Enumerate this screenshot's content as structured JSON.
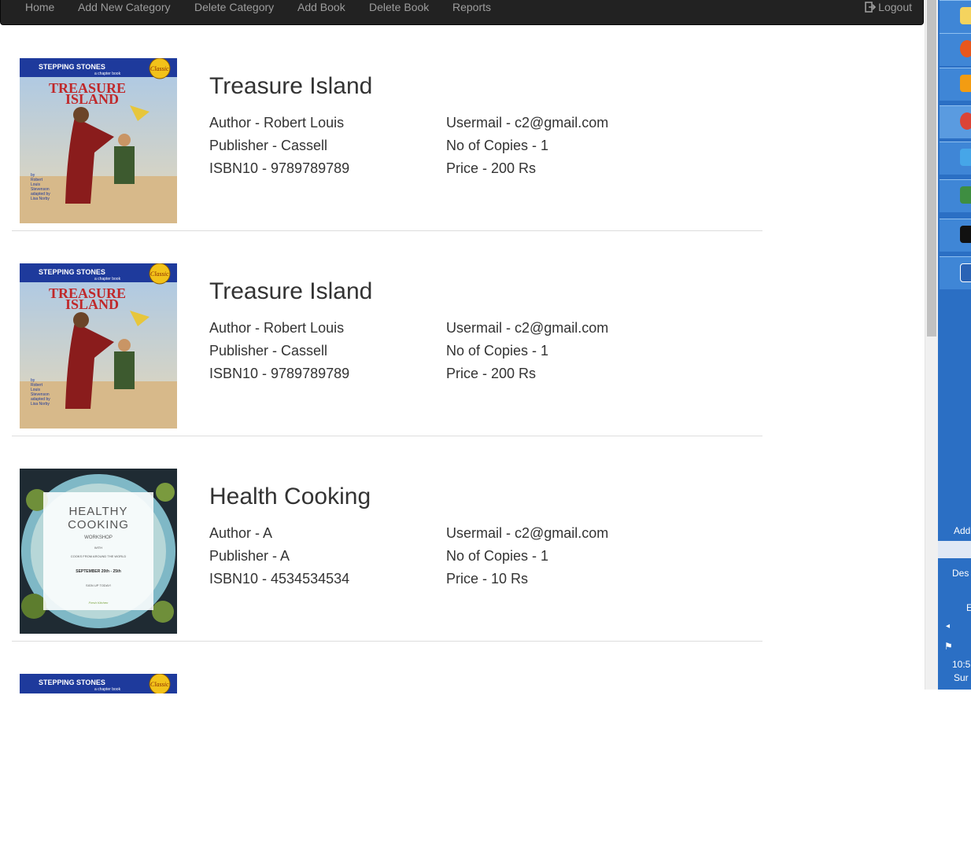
{
  "nav": {
    "items": [
      "Home",
      "Add New Category",
      "Delete Category",
      "Add Book",
      "Delete Book",
      "Reports"
    ],
    "logout": "Logout"
  },
  "books": [
    {
      "title": "Treasure Island",
      "author": "Author - Robert Louis",
      "publisher": "Publisher - Cassell",
      "isbn": "ISBN10 - 9789789789",
      "usermail": "Usermail - c2@gmail.com",
      "copies": "No of Copies - 1",
      "price": "Price - 200 Rs",
      "cover": {
        "series": "STEPPING STONES",
        "tagline": "a chapter book",
        "badge": "Classic",
        "title1": "TREASURE",
        "title2": "ISLAND",
        "credits": [
          "by",
          "Robert",
          "Louis",
          "Stevenson",
          "adapted by",
          "Lisa Norby"
        ]
      }
    },
    {
      "title": "Treasure Island",
      "author": "Author - Robert Louis",
      "publisher": "Publisher - Cassell",
      "isbn": "ISBN10 - 9789789789",
      "usermail": "Usermail - c2@gmail.com",
      "copies": "No of Copies - 1",
      "price": "Price - 200 Rs",
      "cover": {
        "series": "STEPPING STONES",
        "tagline": "a chapter book",
        "badge": "Classic",
        "title1": "TREASURE",
        "title2": "ISLAND",
        "credits": [
          "by",
          "Robert",
          "Louis",
          "Stevenson",
          "adapted by",
          "Lisa Norby"
        ]
      }
    },
    {
      "title": "Health Cooking",
      "author": "Author - A",
      "publisher": "Publisher - A",
      "isbn": "ISBN10 - 4534534534",
      "usermail": "Usermail - c2@gmail.com",
      "copies": "No of Copies - 1",
      "price": "Price - 10 Rs",
      "cover": {
        "title1": "HEALTHY",
        "title2": "COOKING",
        "subtitle": "WORKSHOP",
        "with": "WITH",
        "line1": "COOKS FROM AROUND THE WORLD",
        "dates": "SEPTEMBER 20th - 25th",
        "signup": "SIGN UP TODAY!",
        "sign": "Fresh Kitchen"
      }
    },
    {
      "cover": {
        "series": "STEPPING STONES",
        "tagline": "a chapter book",
        "badge": "Classic"
      }
    }
  ],
  "taskbar": {
    "labels": [
      "Add",
      "Des",
      "E",
      "10:5",
      "Sur"
    ]
  },
  "colors": {
    "navbar_bg": "#222222",
    "nav_text": "#9d9d9d",
    "taskbar_blue": "#2b6fc4",
    "cover_blue_band": "#1e3a9c",
    "title_red": "#c0282a"
  }
}
